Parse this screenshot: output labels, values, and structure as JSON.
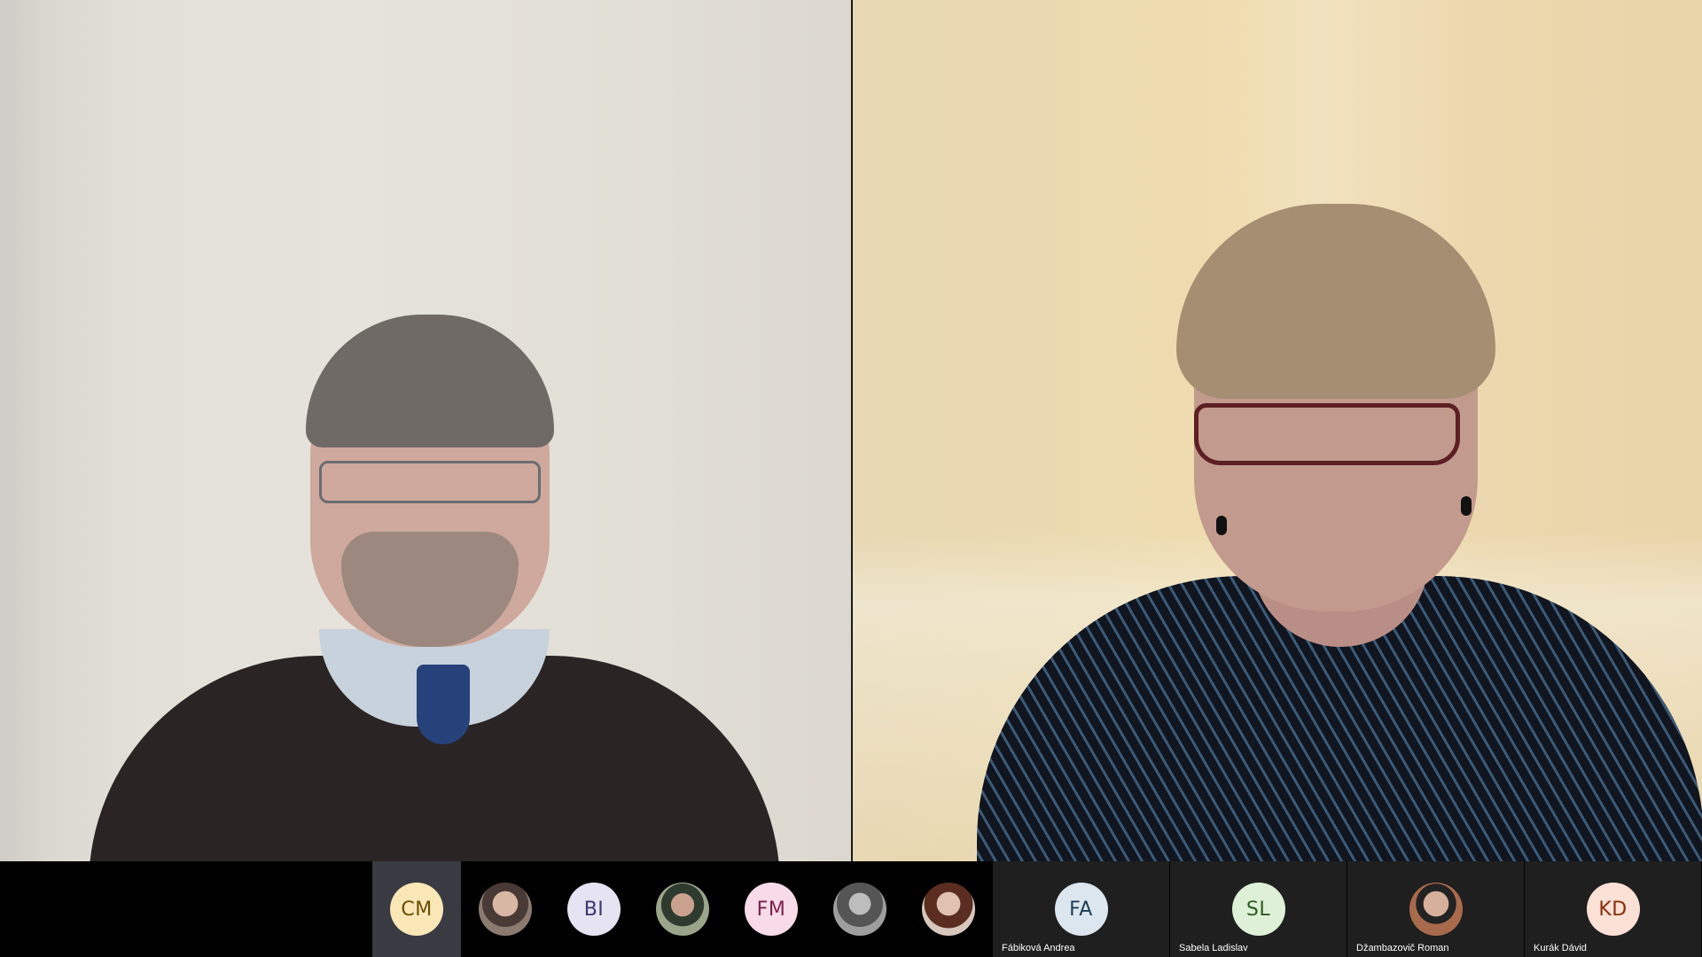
{
  "participants_strip": [
    {
      "initials": "CM",
      "color": "#f9e7b8",
      "text_color": "#6b4d00",
      "active": true,
      "kind": "initials"
    },
    {
      "icon": "user-photo-icon",
      "kind": "photo",
      "variant": "av-photo"
    },
    {
      "initials": "BI",
      "color": "#e6e4f3",
      "text_color": "#3b3670",
      "kind": "initials"
    },
    {
      "icon": "user-photo-icon",
      "kind": "photo",
      "variant": "av-photo2"
    },
    {
      "initials": "FM",
      "color": "#f7dbe8",
      "text_color": "#7a1f4c",
      "kind": "initials"
    },
    {
      "icon": "user-photo-icon",
      "kind": "photo",
      "variant": "av-photo3"
    },
    {
      "icon": "user-photo-icon",
      "kind": "photo",
      "variant": "av-photo4"
    }
  ],
  "named_tiles": [
    {
      "initials": "FA",
      "name": "Fábiková Andrea",
      "color": "#dbe6ee",
      "text_color": "#1d3d55",
      "kind": "initials"
    },
    {
      "initials": "SL",
      "name": "Sabela Ladislav",
      "color": "#dff0d8",
      "text_color": "#2d5a1e",
      "kind": "initials"
    },
    {
      "name": "Džambazovič Roman",
      "kind": "photo",
      "variant": "av-photo5",
      "icon": "user-photo-icon"
    },
    {
      "initials": "KD",
      "name": "Kurák Dávid",
      "color": "#fbe0d5",
      "text_color": "#8a2d0e",
      "kind": "initials"
    }
  ],
  "colors": {
    "background": "#000000",
    "active_slot": "#3a3a42",
    "tile": "#1f1f1f"
  }
}
